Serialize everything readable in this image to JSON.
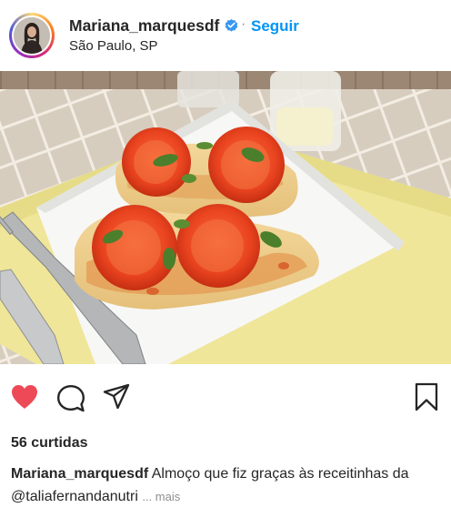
{
  "post": {
    "username": "Mariana_marquesdf",
    "verified": true,
    "separator": "·",
    "follow_label": "Seguir",
    "location": "São Paulo, SP"
  },
  "photo": {
    "subject": "Prato de frango gratinado com tomate e manjericão"
  },
  "actions": {
    "like_icon": "heart-filled-icon",
    "comment_icon": "comment-icon",
    "share_icon": "paper-plane-icon",
    "save_icon": "bookmark-icon",
    "like_color": "#ed4956"
  },
  "likes_text": "56 curtidas",
  "caption": {
    "username": "Mariana_marquesdf",
    "text": "Almoço que fiz graças às receitinhas da @taliafernandanutri",
    "more": "... mais"
  },
  "colors": {
    "accent": "#0095f6",
    "verified": "#3897f0",
    "muted": "#8e8e8e"
  }
}
